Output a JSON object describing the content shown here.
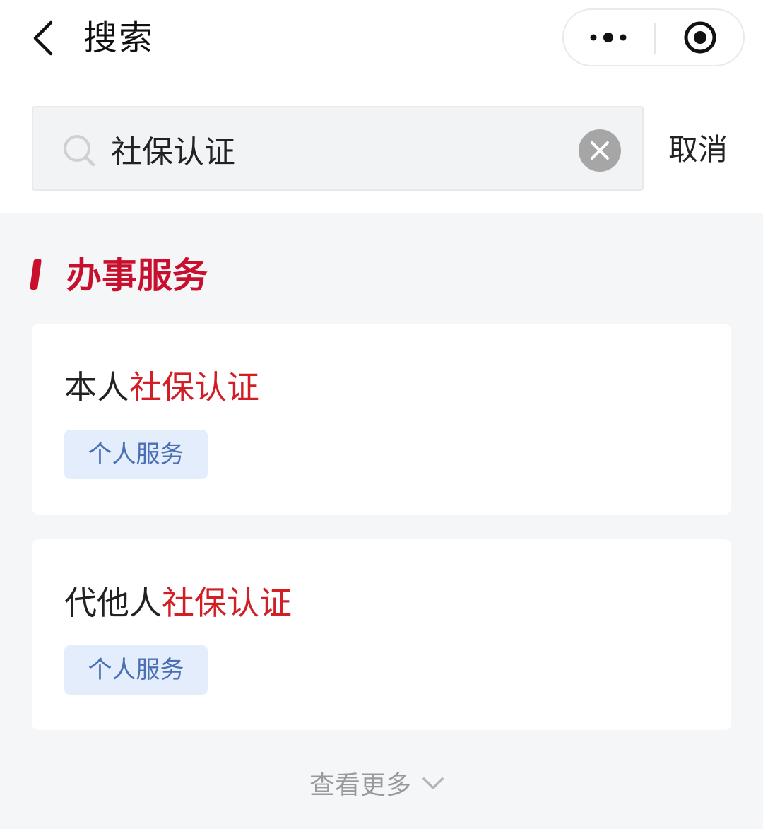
{
  "header": {
    "title": "搜索",
    "back_icon": "chevron-left-icon",
    "more_icon": "more-dots-icon",
    "close_icon": "target-circle-icon"
  },
  "search": {
    "value": "社保认证",
    "placeholder": "",
    "clear_icon": "clear-x-icon",
    "cancel_label": "取消"
  },
  "section": {
    "title": "办事服务",
    "accent_color": "#c8102e"
  },
  "results": [
    {
      "prefix": "本人",
      "highlight": "社保认证",
      "tag": "个人服务"
    },
    {
      "prefix": "代他人",
      "highlight": "社保认证",
      "tag": "个人服务"
    }
  ],
  "view_more": {
    "label": "查看更多",
    "icon": "chevron-down-icon"
  },
  "colors": {
    "highlight": "#d21f26",
    "tag_bg": "#e4edfb",
    "tag_text": "#4a6fb5"
  }
}
